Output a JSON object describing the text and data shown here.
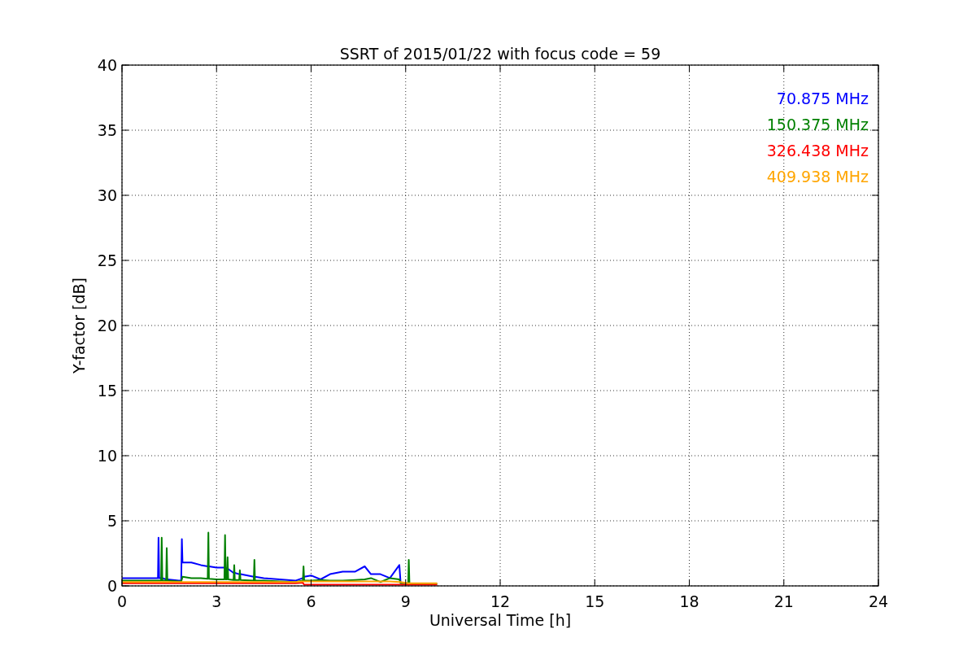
{
  "chart_data": {
    "type": "line",
    "title": "SSRT of 2015/01/22 with focus code = 59",
    "xlabel": "Universal Time [h]",
    "ylabel": "Y-factor [dB]",
    "x": [
      0,
      0.5,
      1.0,
      1.14,
      1.16,
      1.18,
      1.24,
      1.26,
      1.28,
      1.4,
      1.42,
      1.44,
      1.8,
      1.88,
      1.9,
      1.92,
      2.2,
      2.5,
      2.72,
      2.74,
      2.76,
      3.0,
      3.25,
      3.27,
      3.29,
      3.33,
      3.35,
      3.37,
      3.54,
      3.56,
      3.58,
      3.72,
      3.74,
      3.76,
      4.18,
      4.2,
      4.22,
      4.5,
      5.0,
      5.5,
      5.74,
      5.76,
      5.78,
      6.0,
      6.3,
      6.6,
      7.0,
      7.4,
      7.7,
      7.9,
      8.2,
      8.5,
      8.8,
      8.84,
      9.08,
      9.1,
      9.12,
      9.5,
      10.0
    ],
    "series": [
      {
        "name": "70.875 MHz",
        "color": "#0000ff",
        "values": [
          0.6,
          0.6,
          0.6,
          0.6,
          3.7,
          0.6,
          0.6,
          0.6,
          0.6,
          0.5,
          0.5,
          0.5,
          0.4,
          0.4,
          3.6,
          1.8,
          1.8,
          1.6,
          1.5,
          1.5,
          1.5,
          1.4,
          1.4,
          1.4,
          1.4,
          1.3,
          1.3,
          1.3,
          1.0,
          1.0,
          1.0,
          0.9,
          0.9,
          0.9,
          0.7,
          0.7,
          0.7,
          0.6,
          0.5,
          0.4,
          0.6,
          0.7,
          0.7,
          0.8,
          0.5,
          0.9,
          1.1,
          1.1,
          1.5,
          0.9,
          0.9,
          0.6,
          1.6,
          0.2,
          null,
          null,
          null,
          null,
          null
        ]
      },
      {
        "name": "150.375 MHz",
        "color": "#008000",
        "values": [
          0.4,
          0.4,
          0.4,
          0.4,
          0.4,
          0.4,
          0.4,
          3.7,
          0.4,
          0.4,
          2.9,
          0.4,
          0.35,
          0.35,
          0.5,
          0.7,
          0.6,
          0.6,
          0.55,
          4.1,
          0.55,
          0.5,
          0.5,
          3.9,
          0.5,
          0.5,
          2.2,
          0.5,
          0.45,
          1.6,
          0.45,
          0.45,
          1.2,
          0.45,
          0.4,
          2.0,
          0.4,
          0.4,
          0.35,
          0.3,
          0.4,
          1.5,
          0.4,
          0.4,
          0.45,
          0.4,
          0.4,
          0.45,
          0.5,
          0.6,
          0.3,
          0.6,
          0.5,
          0.2,
          0.2,
          2.0,
          0.2,
          0.15,
          0.15
        ]
      },
      {
        "name": "326.438 MHz",
        "color": "#ff0000",
        "values": [
          0.2,
          0.2,
          0.2,
          0.2,
          0.2,
          0.2,
          0.2,
          0.2,
          0.2,
          0.2,
          0.2,
          0.2,
          0.2,
          0.2,
          0.2,
          0.2,
          0.2,
          0.2,
          0.2,
          0.2,
          0.2,
          0.2,
          0.2,
          0.2,
          0.2,
          0.2,
          0.2,
          0.2,
          0.2,
          0.2,
          0.2,
          0.2,
          0.2,
          0.2,
          0.2,
          0.2,
          0.2,
          0.2,
          0.2,
          0.2,
          0.25,
          0.15,
          0.1,
          0.1,
          0.1,
          0.1,
          0.1,
          0.1,
          0.1,
          0.1,
          0.1,
          0.1,
          0.1,
          0.1,
          0.1,
          0.1,
          0.1,
          0.1,
          0.1
        ]
      },
      {
        "name": "409.938 MHz",
        "color": "#ffa500",
        "values": [
          0.3,
          0.3,
          0.3,
          0.3,
          0.3,
          0.3,
          0.3,
          0.3,
          0.3,
          0.3,
          0.3,
          0.3,
          0.3,
          0.3,
          0.3,
          0.3,
          0.3,
          0.3,
          0.3,
          0.3,
          0.3,
          0.3,
          0.3,
          0.3,
          0.3,
          0.3,
          0.3,
          0.3,
          0.3,
          0.3,
          0.3,
          0.3,
          0.3,
          0.3,
          0.3,
          0.3,
          0.3,
          0.3,
          0.3,
          0.3,
          0.35,
          0.35,
          0.35,
          0.35,
          0.35,
          0.35,
          0.35,
          0.35,
          0.35,
          0.35,
          0.35,
          0.35,
          0.3,
          0.3,
          0.2,
          0.2,
          0.2,
          0.2,
          0.2
        ]
      }
    ],
    "grid": true,
    "xlim": [
      0,
      24
    ],
    "ylim": [
      0,
      40
    ],
    "xticks": [
      0,
      3,
      6,
      9,
      12,
      15,
      18,
      21,
      24
    ],
    "yticks": [
      0,
      5,
      10,
      15,
      20,
      25,
      30,
      35,
      40
    ]
  }
}
